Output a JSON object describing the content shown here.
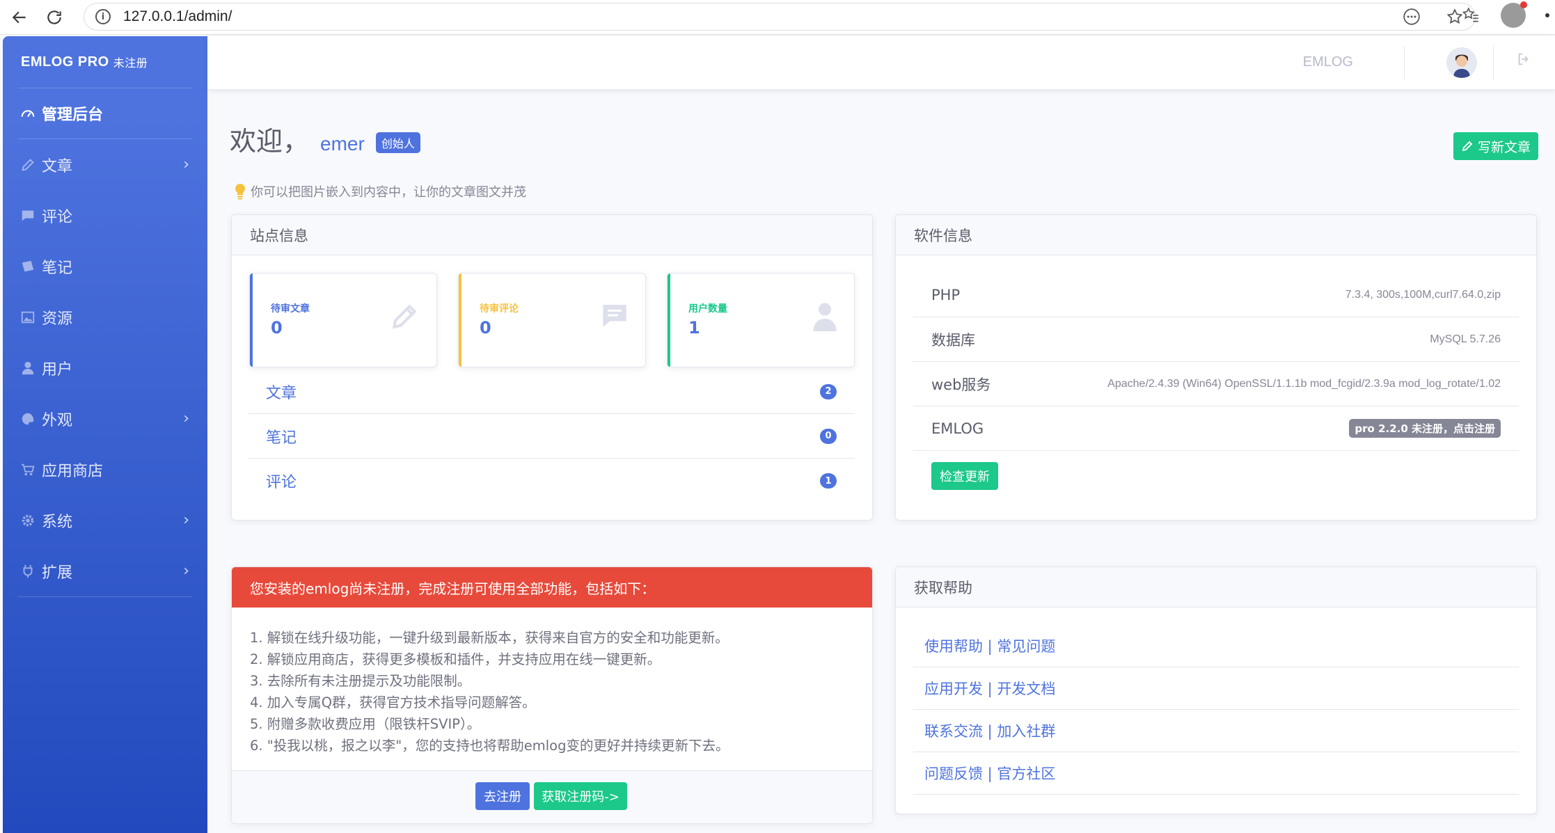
{
  "browser": {
    "url": "127.0.0.1/admin/",
    "back_icon": "back-arrow-icon",
    "reload_icon": "reload-icon"
  },
  "sidebar": {
    "brand": "EMLOG PRO",
    "brand_sub": "未注册",
    "items": [
      {
        "label": "管理后台",
        "icon": "dashboard-icon",
        "active": true
      },
      {
        "label": "文章",
        "icon": "pencil-icon",
        "chevron": true
      },
      {
        "label": "评论",
        "icon": "comment-icon"
      },
      {
        "label": "笔记",
        "icon": "sticky-note-icon"
      },
      {
        "label": "资源",
        "icon": "image-icon"
      },
      {
        "label": "用户",
        "icon": "user-icon"
      },
      {
        "label": "外观",
        "icon": "palette-icon",
        "chevron": true
      },
      {
        "label": "应用商店",
        "icon": "cart-icon"
      },
      {
        "label": "系统",
        "icon": "gear-icon",
        "chevron": true
      },
      {
        "label": "扩展",
        "icon": "plug-icon",
        "chevron": true
      }
    ]
  },
  "topbar": {
    "emlog_link": "EMLOG"
  },
  "welcome": {
    "greeting": "欢迎，",
    "username": "emer",
    "role_badge": "创始人",
    "write_button": "写新文章",
    "tip": "你可以把图片嵌入到内容中，让你的文章图文并茂"
  },
  "site_info": {
    "title": "站点信息",
    "stats": [
      {
        "label": "待审文章",
        "value": "0",
        "color": "#4e73df"
      },
      {
        "label": "待审评论",
        "value": "0",
        "color": "#f6c23e"
      },
      {
        "label": "用户数量",
        "value": "1",
        "color": "#1cc88a"
      }
    ],
    "counts": [
      {
        "label": "文章",
        "value": "2"
      },
      {
        "label": "笔记",
        "value": "0"
      },
      {
        "label": "评论",
        "value": "1"
      }
    ]
  },
  "software_info": {
    "title": "软件信息",
    "rows": [
      {
        "key": "PHP",
        "value": "7.3.4, 300s,100M,curl7.64.0,zip"
      },
      {
        "key": "数据库",
        "value": "MySQL 5.7.26"
      },
      {
        "key": "web服务",
        "value": "Apache/2.4.39 (Win64) OpenSSL/1.1.1b mod_fcgid/2.3.9a mod_log_rotate/1.02"
      },
      {
        "key": "EMLOG",
        "value": "pro 2.2.0 未注册，点击注册"
      }
    ],
    "check_update": "检查更新"
  },
  "register": {
    "header": "您安装的emlog尚未注册，完成注册可使用全部功能，包括如下：",
    "items": [
      "1. 解锁在线升级功能，一键升级到最新版本，获得来自官方的安全和功能更新。",
      "2. 解锁应用商店，获得更多模板和插件，并支持应用在线一键更新。",
      "3. 去除所有未注册提示及功能限制。",
      "4. 加入专属Q群，获得官方技术指导问题解答。",
      "5. 附赠多款收费应用（限铁杆SVIP）。",
      "6. \"投我以桃，报之以李\"，您的支持也将帮助emlog变的更好并持续更新下去。"
    ],
    "register_button": "去注册",
    "get_code_button": "获取注册码->"
  },
  "help": {
    "title": "获取帮助",
    "links": [
      "使用帮助 | 常见问题",
      "应用开发 | 开发文档",
      "联系交流 | 加入社群",
      "问题反馈 | 官方社区"
    ]
  }
}
